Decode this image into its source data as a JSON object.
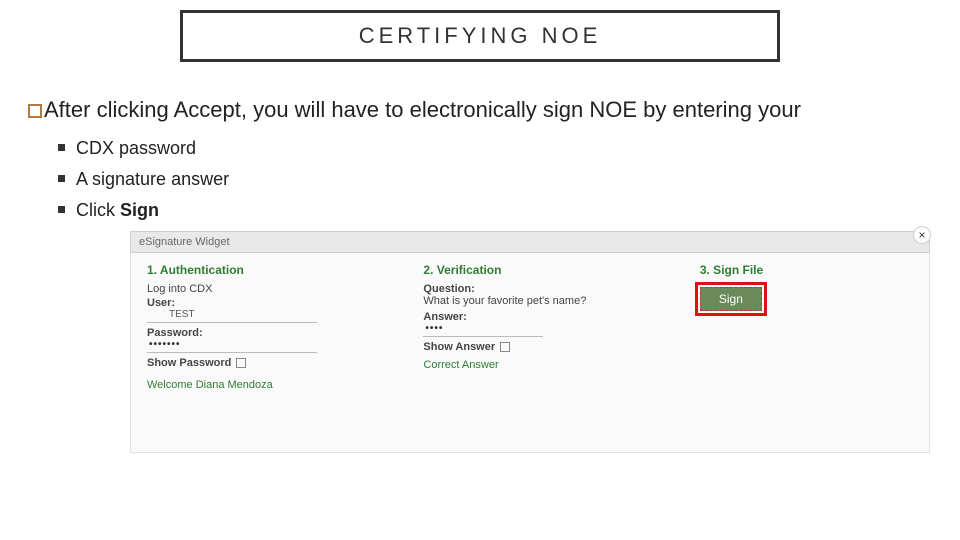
{
  "title": "CERTIFYING NOE",
  "intro": "After clicking Accept, you will have to electronically sign NOE by entering your",
  "bullets": {
    "b1": "CDX password",
    "b2": "A signature answer",
    "b3_pre": "Click ",
    "b3_bold": "Sign"
  },
  "widget": {
    "header": "eSignature Widget",
    "close": "×",
    "auth": {
      "heading": "1. Authentication",
      "login": "Log into CDX",
      "user_label": "User:",
      "user_value": "TEST",
      "pwd_label": "Password:",
      "pwd_value": "•••••••",
      "show": "Show Password",
      "welcome": "Welcome Diana Mendoza"
    },
    "verify": {
      "heading": "2. Verification",
      "q_label": "Question:",
      "q_text": "What is your favorite pet's name?",
      "a_label": "Answer:",
      "a_value": "••••",
      "show": "Show Answer",
      "correct": "Correct Answer"
    },
    "sign": {
      "heading": "3. Sign File",
      "button": "Sign"
    }
  }
}
